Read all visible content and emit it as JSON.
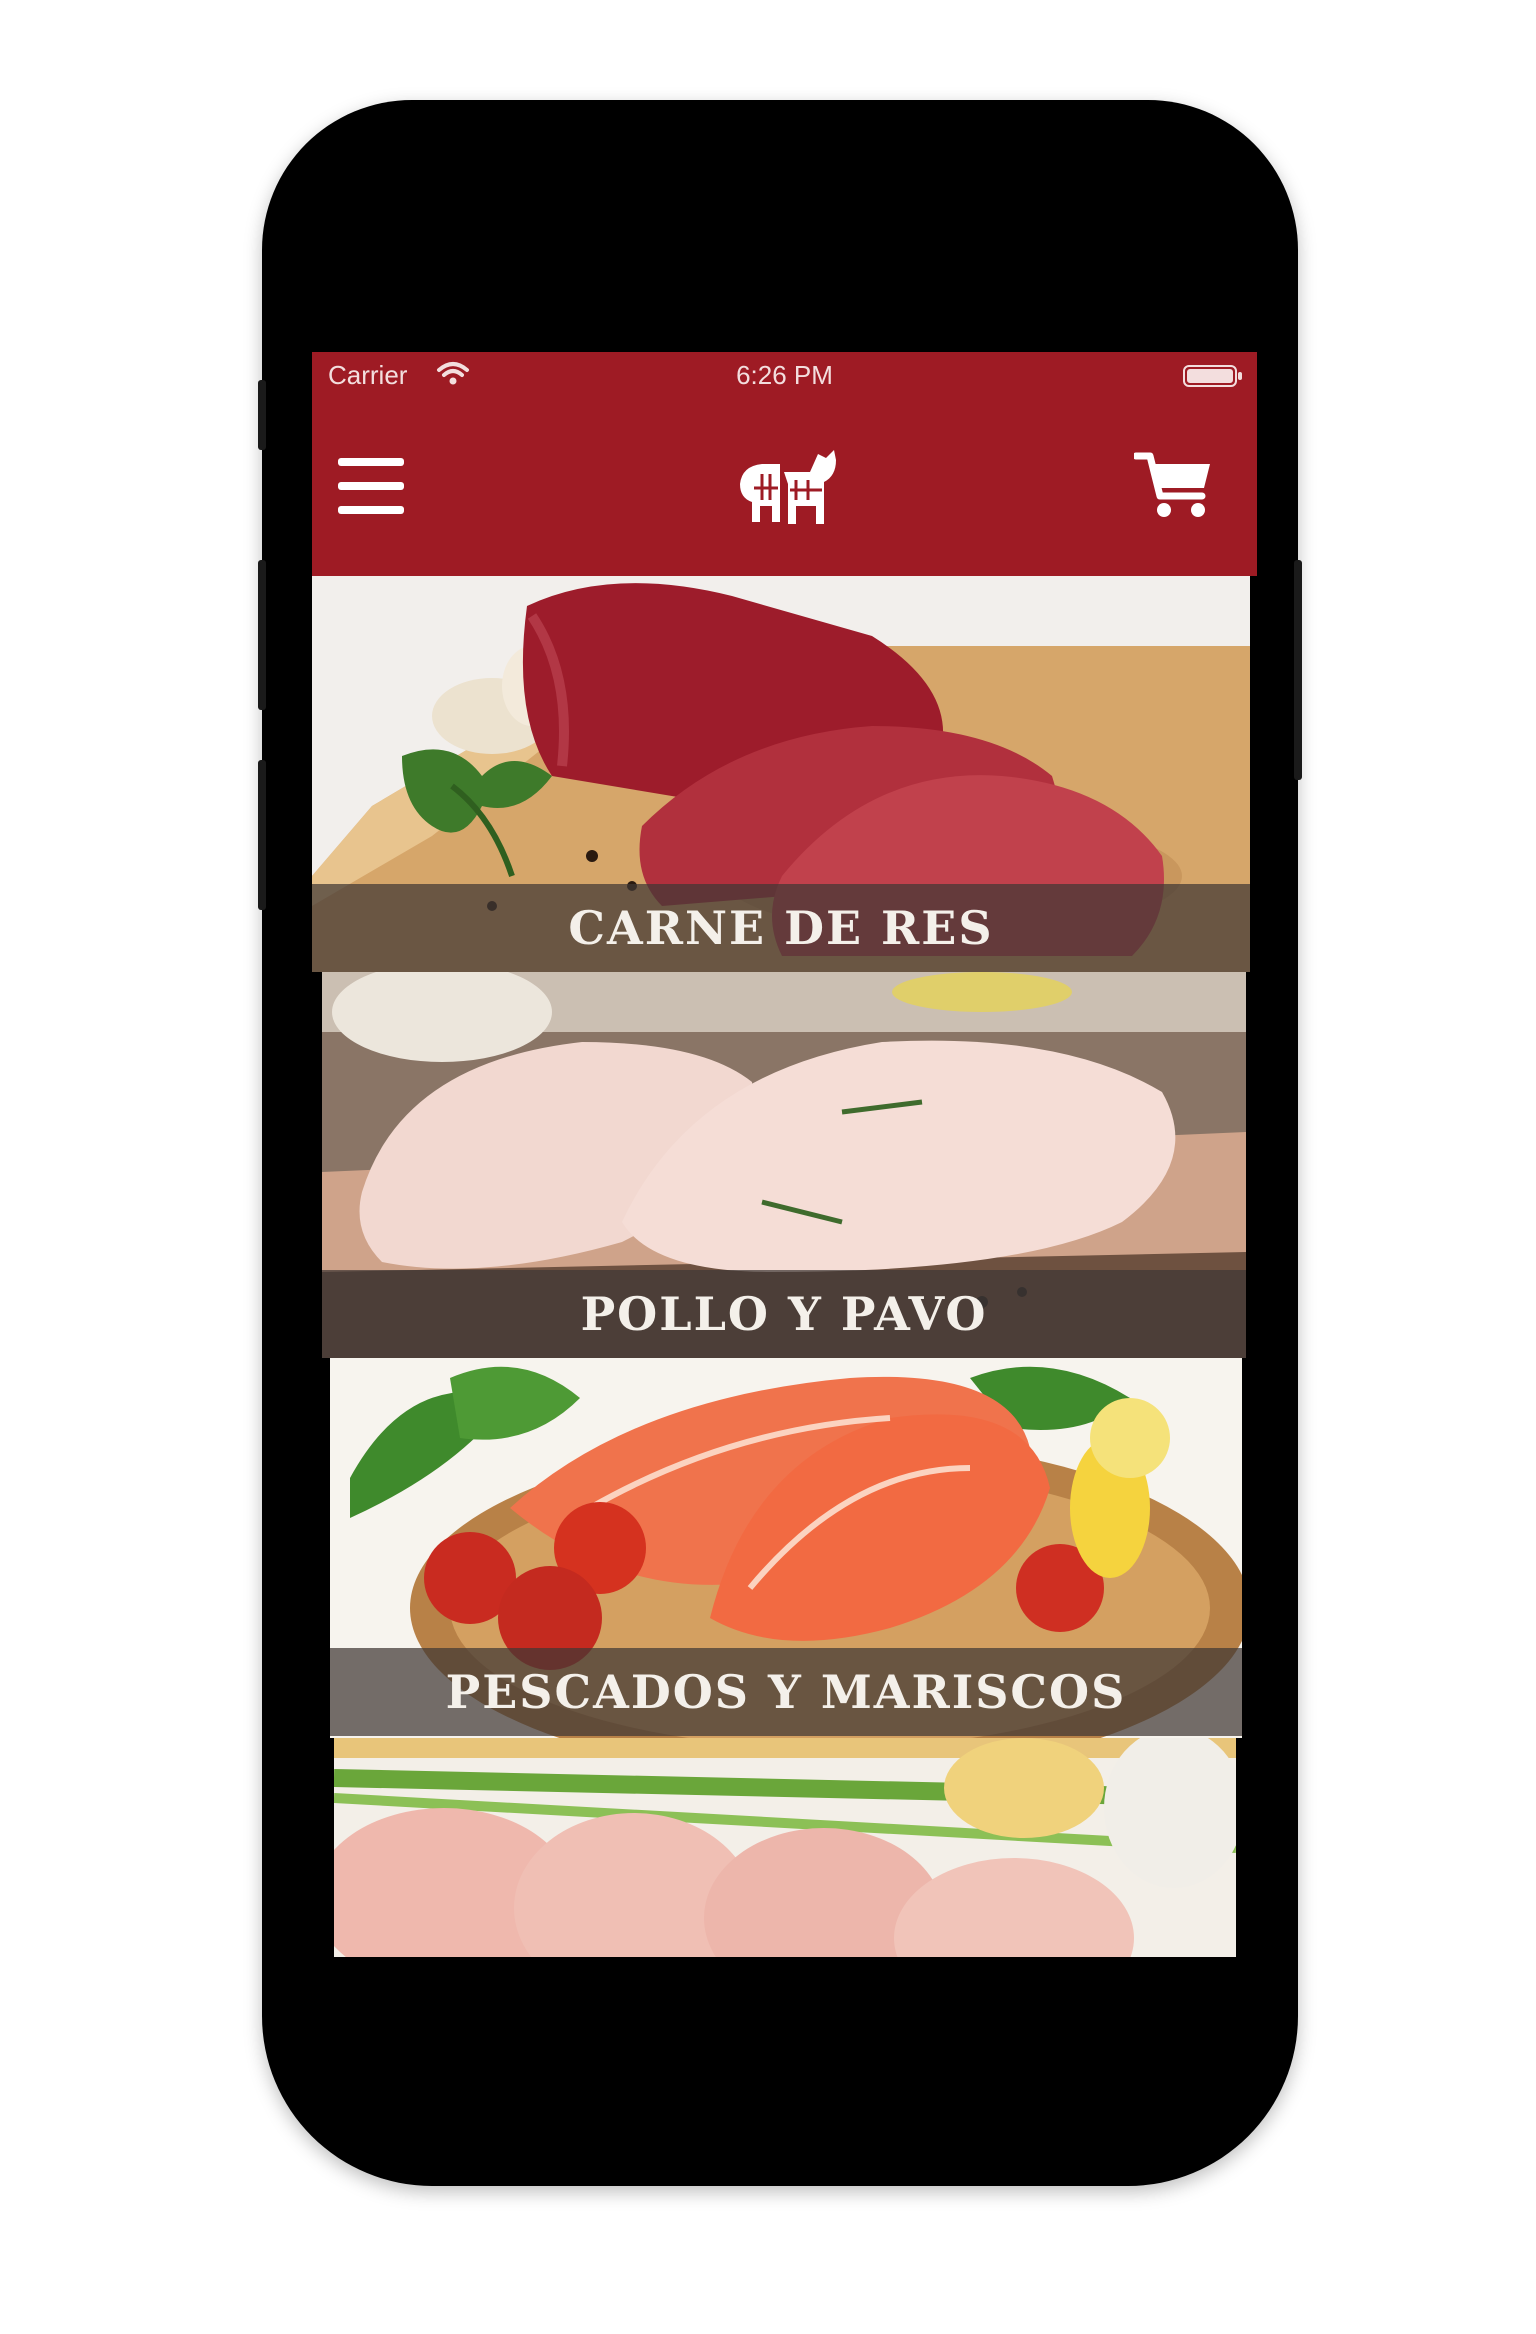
{
  "status_bar": {
    "carrier": "Carrier",
    "time": "6:26 PM"
  },
  "header": {
    "menu_icon": "hamburger-menu-icon",
    "logo_icon": "butcher-animals-logo-icon",
    "cart_icon": "shopping-cart-icon",
    "brand_color": "#9e1b24"
  },
  "categories": [
    {
      "label": "CARNE DE RES"
    },
    {
      "label": "POLLO Y PAVO"
    },
    {
      "label": "PESCADOS Y MARISCOS"
    },
    {
      "label": ""
    }
  ]
}
